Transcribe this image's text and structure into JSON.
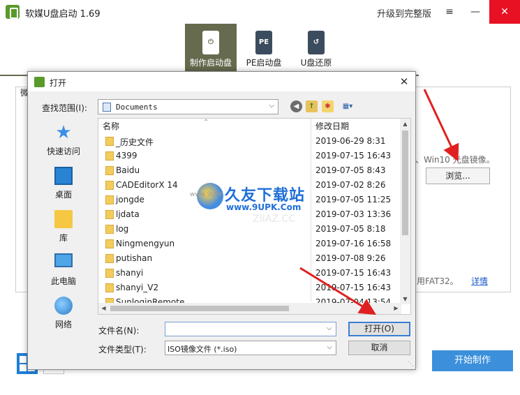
{
  "app": {
    "title": "软媒U盘启动 1.69",
    "upgrade": "升级到完整版",
    "menu_icon": "≡",
    "min_icon": "—",
    "close_icon": "✕"
  },
  "nav": [
    {
      "label": "制作启动盘",
      "icon": "power-usb-icon",
      "glyph": "⏻",
      "active": true
    },
    {
      "label": "PE启动盘",
      "icon": "pe-usb-icon",
      "glyph": "PE",
      "active": false
    },
    {
      "label": "U盘还原",
      "icon": "restore-usb-icon",
      "glyph": "↺",
      "active": false
    }
  ],
  "main": {
    "group_label_fragment": "微",
    "desc_text": "、Win10 光盘镜像。",
    "browse_label": "浏览...",
    "fat_text": "用FAT32。",
    "detail_link": "详情",
    "start_label": "开始制作"
  },
  "dialog": {
    "title": "打开",
    "close_glyph": "✕",
    "lookin_label": "查找范围(I):",
    "lookin_value": "Documents",
    "places": [
      "快速访问",
      "桌面",
      "库",
      "此电脑",
      "网络"
    ],
    "columns": {
      "name": "名称",
      "date": "修改日期"
    },
    "files": [
      {
        "name": "_历史文件",
        "date": "2019-06-29 8:31"
      },
      {
        "name": "4399",
        "date": "2019-07-15 16:43"
      },
      {
        "name": "Baidu",
        "date": "2019-07-05 8:43"
      },
      {
        "name": "CADEditorX 14",
        "date": "2019-07-02 8:26"
      },
      {
        "name": "jongde",
        "date": "2019-07-05 11:25"
      },
      {
        "name": "ljdata",
        "date": "2019-07-03 13:36"
      },
      {
        "name": "log",
        "date": "2019-07-05 8:18"
      },
      {
        "name": "Ningmengyun",
        "date": "2019-07-16 16:58"
      },
      {
        "name": "putishan",
        "date": "2019-07-08 9:26"
      },
      {
        "name": "shanyi",
        "date": "2019-07-15 16:43"
      },
      {
        "name": "shanyi_V2",
        "date": "2019-07-15 16:43"
      },
      {
        "name": "SunloginRemote",
        "date": "2019-07-04 13:54"
      }
    ],
    "filename_label": "文件名(N):",
    "filename_value": "",
    "filetype_label": "文件类型(T):",
    "filetype_value": "ISO镜像文件 (*.iso)",
    "open_label": "打开(O)",
    "cancel_label": "取消"
  },
  "watermark": {
    "brand": "久友下载站",
    "url": "www.9UPK.Com",
    "left_text": "www.9UPK.",
    "faint": "ZIIAZ.CC"
  },
  "colors": {
    "nav_active": "#666a4e",
    "start_button": "#3b8fdb",
    "close_button": "#e81123",
    "arrow_red": "#e02020"
  }
}
